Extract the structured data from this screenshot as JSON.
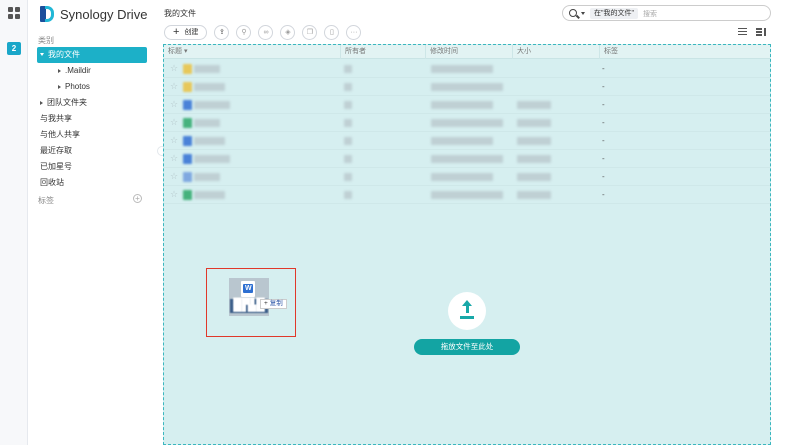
{
  "app": {
    "logo_text": "Synology Drive",
    "badge_count": "2"
  },
  "sidebar": {
    "category_label": "类别",
    "items": [
      {
        "label": "我的文件",
        "level": 0,
        "arrow": "down",
        "active": true
      },
      {
        "label": ".Maildir",
        "level": 1,
        "arrow": "right",
        "active": false
      },
      {
        "label": "Photos",
        "level": 1,
        "arrow": "right",
        "active": false
      },
      {
        "label": "团队文件夹",
        "level": 0,
        "arrow": "right",
        "active": false
      },
      {
        "label": "与我共享",
        "level": 0,
        "arrow": "none",
        "active": false
      },
      {
        "label": "与他人共享",
        "level": 0,
        "arrow": "none",
        "active": false
      },
      {
        "label": "最近存取",
        "level": 0,
        "arrow": "none",
        "active": false
      },
      {
        "label": "已加星号",
        "level": 0,
        "arrow": "none",
        "active": false
      },
      {
        "label": "回收站",
        "level": 0,
        "arrow": "none",
        "active": false
      }
    ],
    "tags_label": "标签",
    "add_tag_symbol": "+"
  },
  "main": {
    "title": "我的文件",
    "search": {
      "scope": "在\"我的文件\"",
      "placeholder": "搜索"
    },
    "toolbar": {
      "create_label": "创建"
    },
    "columns": [
      "标题",
      "所有者",
      "修改时间",
      "大小",
      "标签"
    ],
    "rows": [
      {
        "icon": "folder-icon",
        "icon_color": "#e7c85a",
        "has_size": false,
        "tag": "-"
      },
      {
        "icon": "folder-icon",
        "icon_color": "#e7c85a",
        "has_size": false,
        "tag": "-"
      },
      {
        "icon": "word-file-icon",
        "icon_color": "#4a82d8",
        "has_size": true,
        "tag": "-"
      },
      {
        "icon": "excel-file-icon",
        "icon_color": "#45b27d",
        "has_size": true,
        "tag": "-"
      },
      {
        "icon": "word-file-icon",
        "icon_color": "#4a82d8",
        "has_size": true,
        "tag": "-"
      },
      {
        "icon": "word-file-icon",
        "icon_color": "#4a82d8",
        "has_size": true,
        "tag": "-"
      },
      {
        "icon": "image-file-icon",
        "icon_color": "#7fa8e0",
        "has_size": true,
        "tag": "-"
      },
      {
        "icon": "excel-file-icon",
        "icon_color": "#45b27d",
        "has_size": true,
        "tag": "-"
      }
    ],
    "drop_button": "拖放文件至此处",
    "drag": {
      "file_badge": "W",
      "copy_symbol": "+",
      "copy_label": "复制"
    }
  },
  "colors": {
    "accent": "#1cb0c8",
    "drop_zone": "#d6eff0",
    "drop_button": "#13a4a3",
    "highlight_frame": "#e0382a"
  }
}
